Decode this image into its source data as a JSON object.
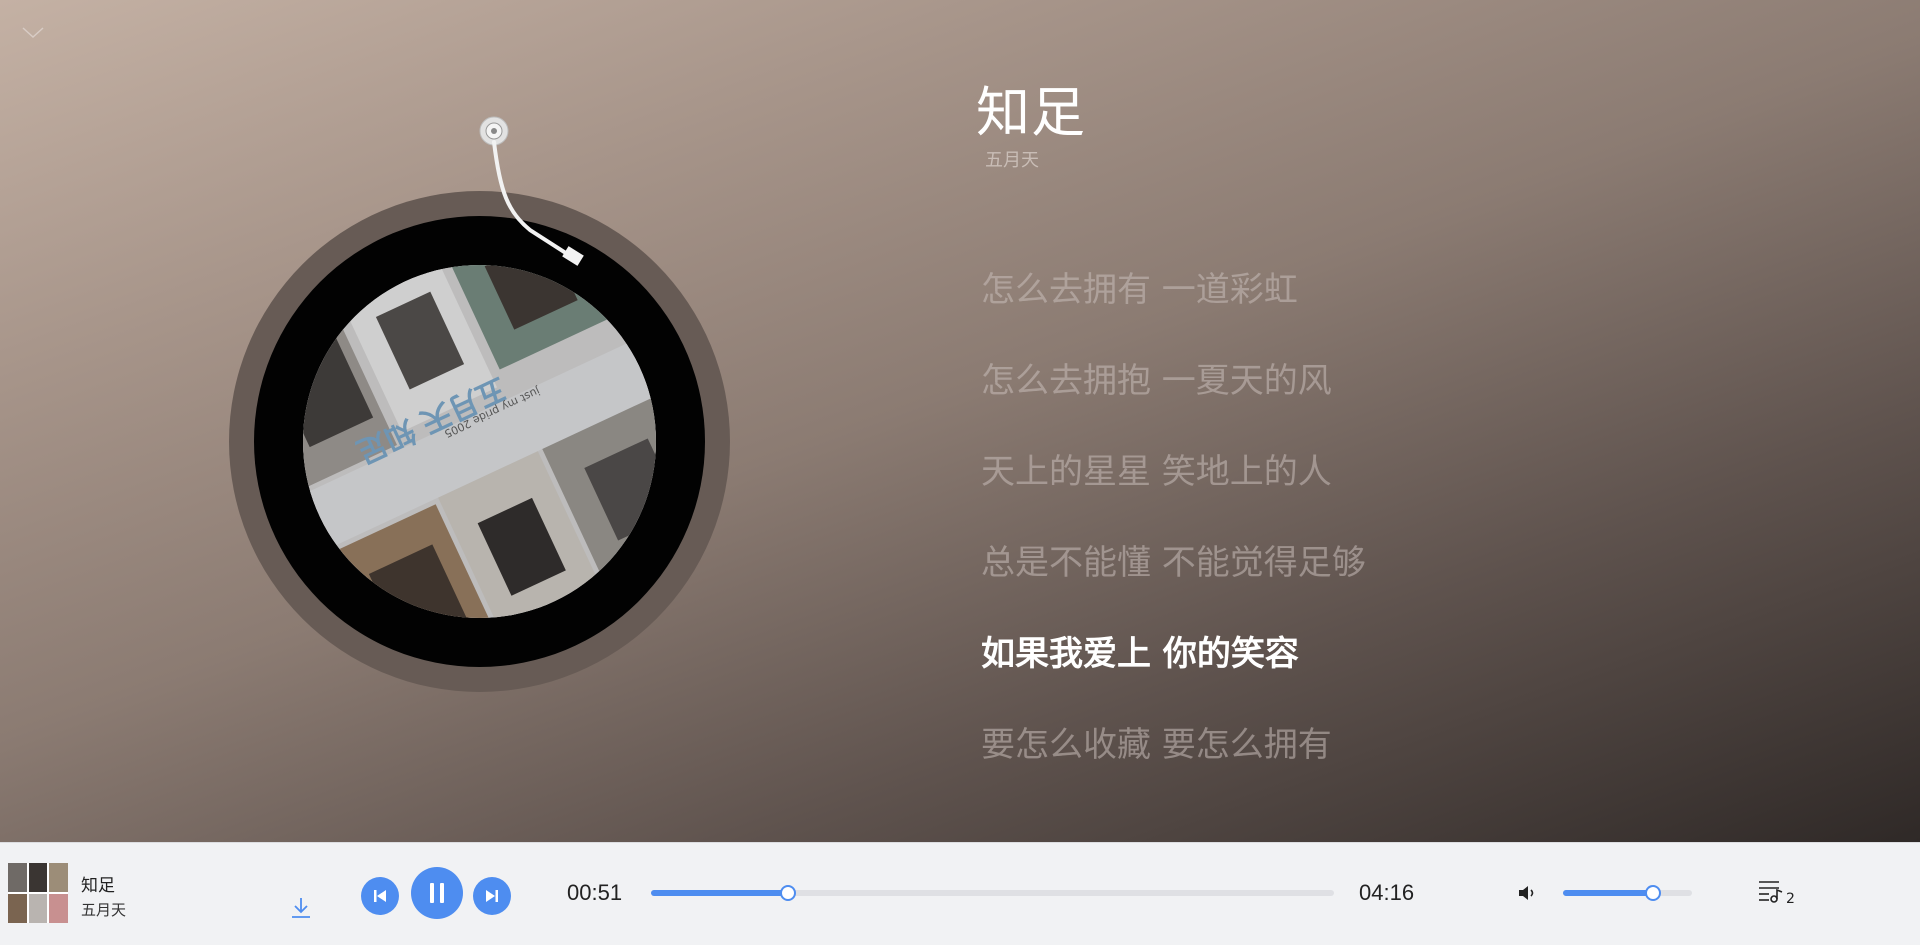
{
  "now_playing": {
    "title": "知足",
    "artist": "五月天"
  },
  "lyrics": [
    {
      "text": "怎么去拥有 一道彩虹",
      "active": false
    },
    {
      "text": "怎么去拥抱 一夏天的风",
      "active": false
    },
    {
      "text": "天上的星星 笑地上的人",
      "active": false
    },
    {
      "text": "总是不能懂 不能觉得足够",
      "active": false
    },
    {
      "text": "如果我爱上 你的笑容",
      "active": true
    },
    {
      "text": "要怎么收藏 要怎么拥有",
      "active": false
    }
  ],
  "album_art": {
    "text": "五月天 知足",
    "subtext": "just my pride 2005"
  },
  "player": {
    "title": "知足",
    "artist": "五月天",
    "current_time": "00:51",
    "total_time": "04:16",
    "progress_fraction": 0.2,
    "volume_fraction": 0.7,
    "queue_count": "2",
    "state": "playing"
  },
  "icons": {
    "collapse": "chevron-down-icon",
    "download": "download-icon",
    "prev": "skip-previous-icon",
    "play_pause": "pause-icon",
    "next": "skip-next-icon",
    "volume": "speaker-icon",
    "playlist": "playlist-icon"
  },
  "colors": {
    "accent": "#4e8df0",
    "active_lyric": "#ffffff",
    "inactive_lyric": "#b0a39c"
  }
}
